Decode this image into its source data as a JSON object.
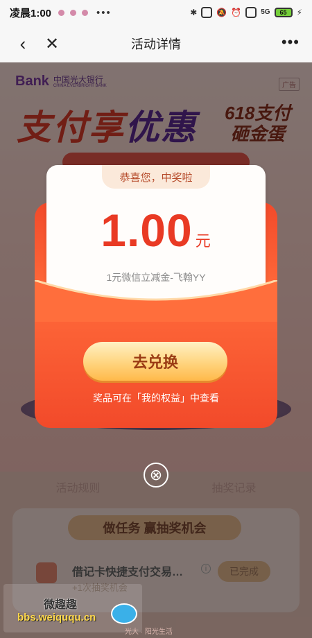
{
  "status": {
    "time": "凌晨1:00",
    "net": "5G",
    "battery": "65"
  },
  "nav": {
    "back": "‹",
    "close": "✕",
    "title": "活动详情",
    "menu": "•••"
  },
  "bg": {
    "bank_mark": "Bank",
    "bank_cn": "中国光大银行",
    "bank_en": "CHINA EVERBRIGHT BANK",
    "ad": "广告",
    "hero_left": "支付享",
    "hero_highlight": "优惠",
    "hero_right_1": "618支付",
    "hero_right_2": "砸金蛋"
  },
  "modal": {
    "header": "恭喜您，中奖啦",
    "amount": "1.00",
    "unit": "元",
    "description": "1元微信立减金-飞翰YY",
    "redeem": "去兑换",
    "hint": "奖品可在「我的权益」中查看",
    "close_glyph": "⊗"
  },
  "tabs": {
    "rules": "活动规则",
    "records": "抽奖记录"
  },
  "task": {
    "header": "做任务 赢抽奖机会",
    "title": "借记卡快捷支付交易…",
    "sub": "+1次抽奖机会",
    "done": "已完成",
    "info": "i"
  },
  "footer": "光大 · 阳光生活",
  "watermark": {
    "line1": "微趣趣",
    "line2": "bbs.weiququ.cn"
  }
}
